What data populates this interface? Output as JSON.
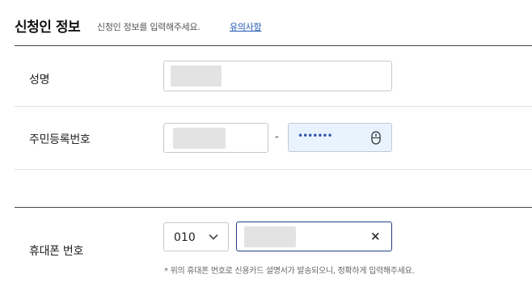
{
  "header": {
    "title": "신청인 정보",
    "description": "신청인 정보를 입력해주세요.",
    "notice_link": "유의사항"
  },
  "fields": {
    "name": {
      "label": "성명"
    },
    "resident_number": {
      "label": "주민등록번호",
      "separator": "-",
      "masked_value": "•••••••"
    },
    "phone": {
      "label": "휴대폰 번호",
      "prefix_selected": "010",
      "note": "*  위의 휴대폰 번호로 신용카드 설명서가 발송되오니, 정확하게 입력해주세요."
    }
  },
  "icons": {
    "password_toggle": "mouse-icon",
    "prefix_dropdown": "chevron-down-icon",
    "clear_phone": "close-icon"
  },
  "colors": {
    "link": "#1f56b3",
    "focused_border": "#22418a",
    "secure_field_bg": "#e8f3fd"
  }
}
